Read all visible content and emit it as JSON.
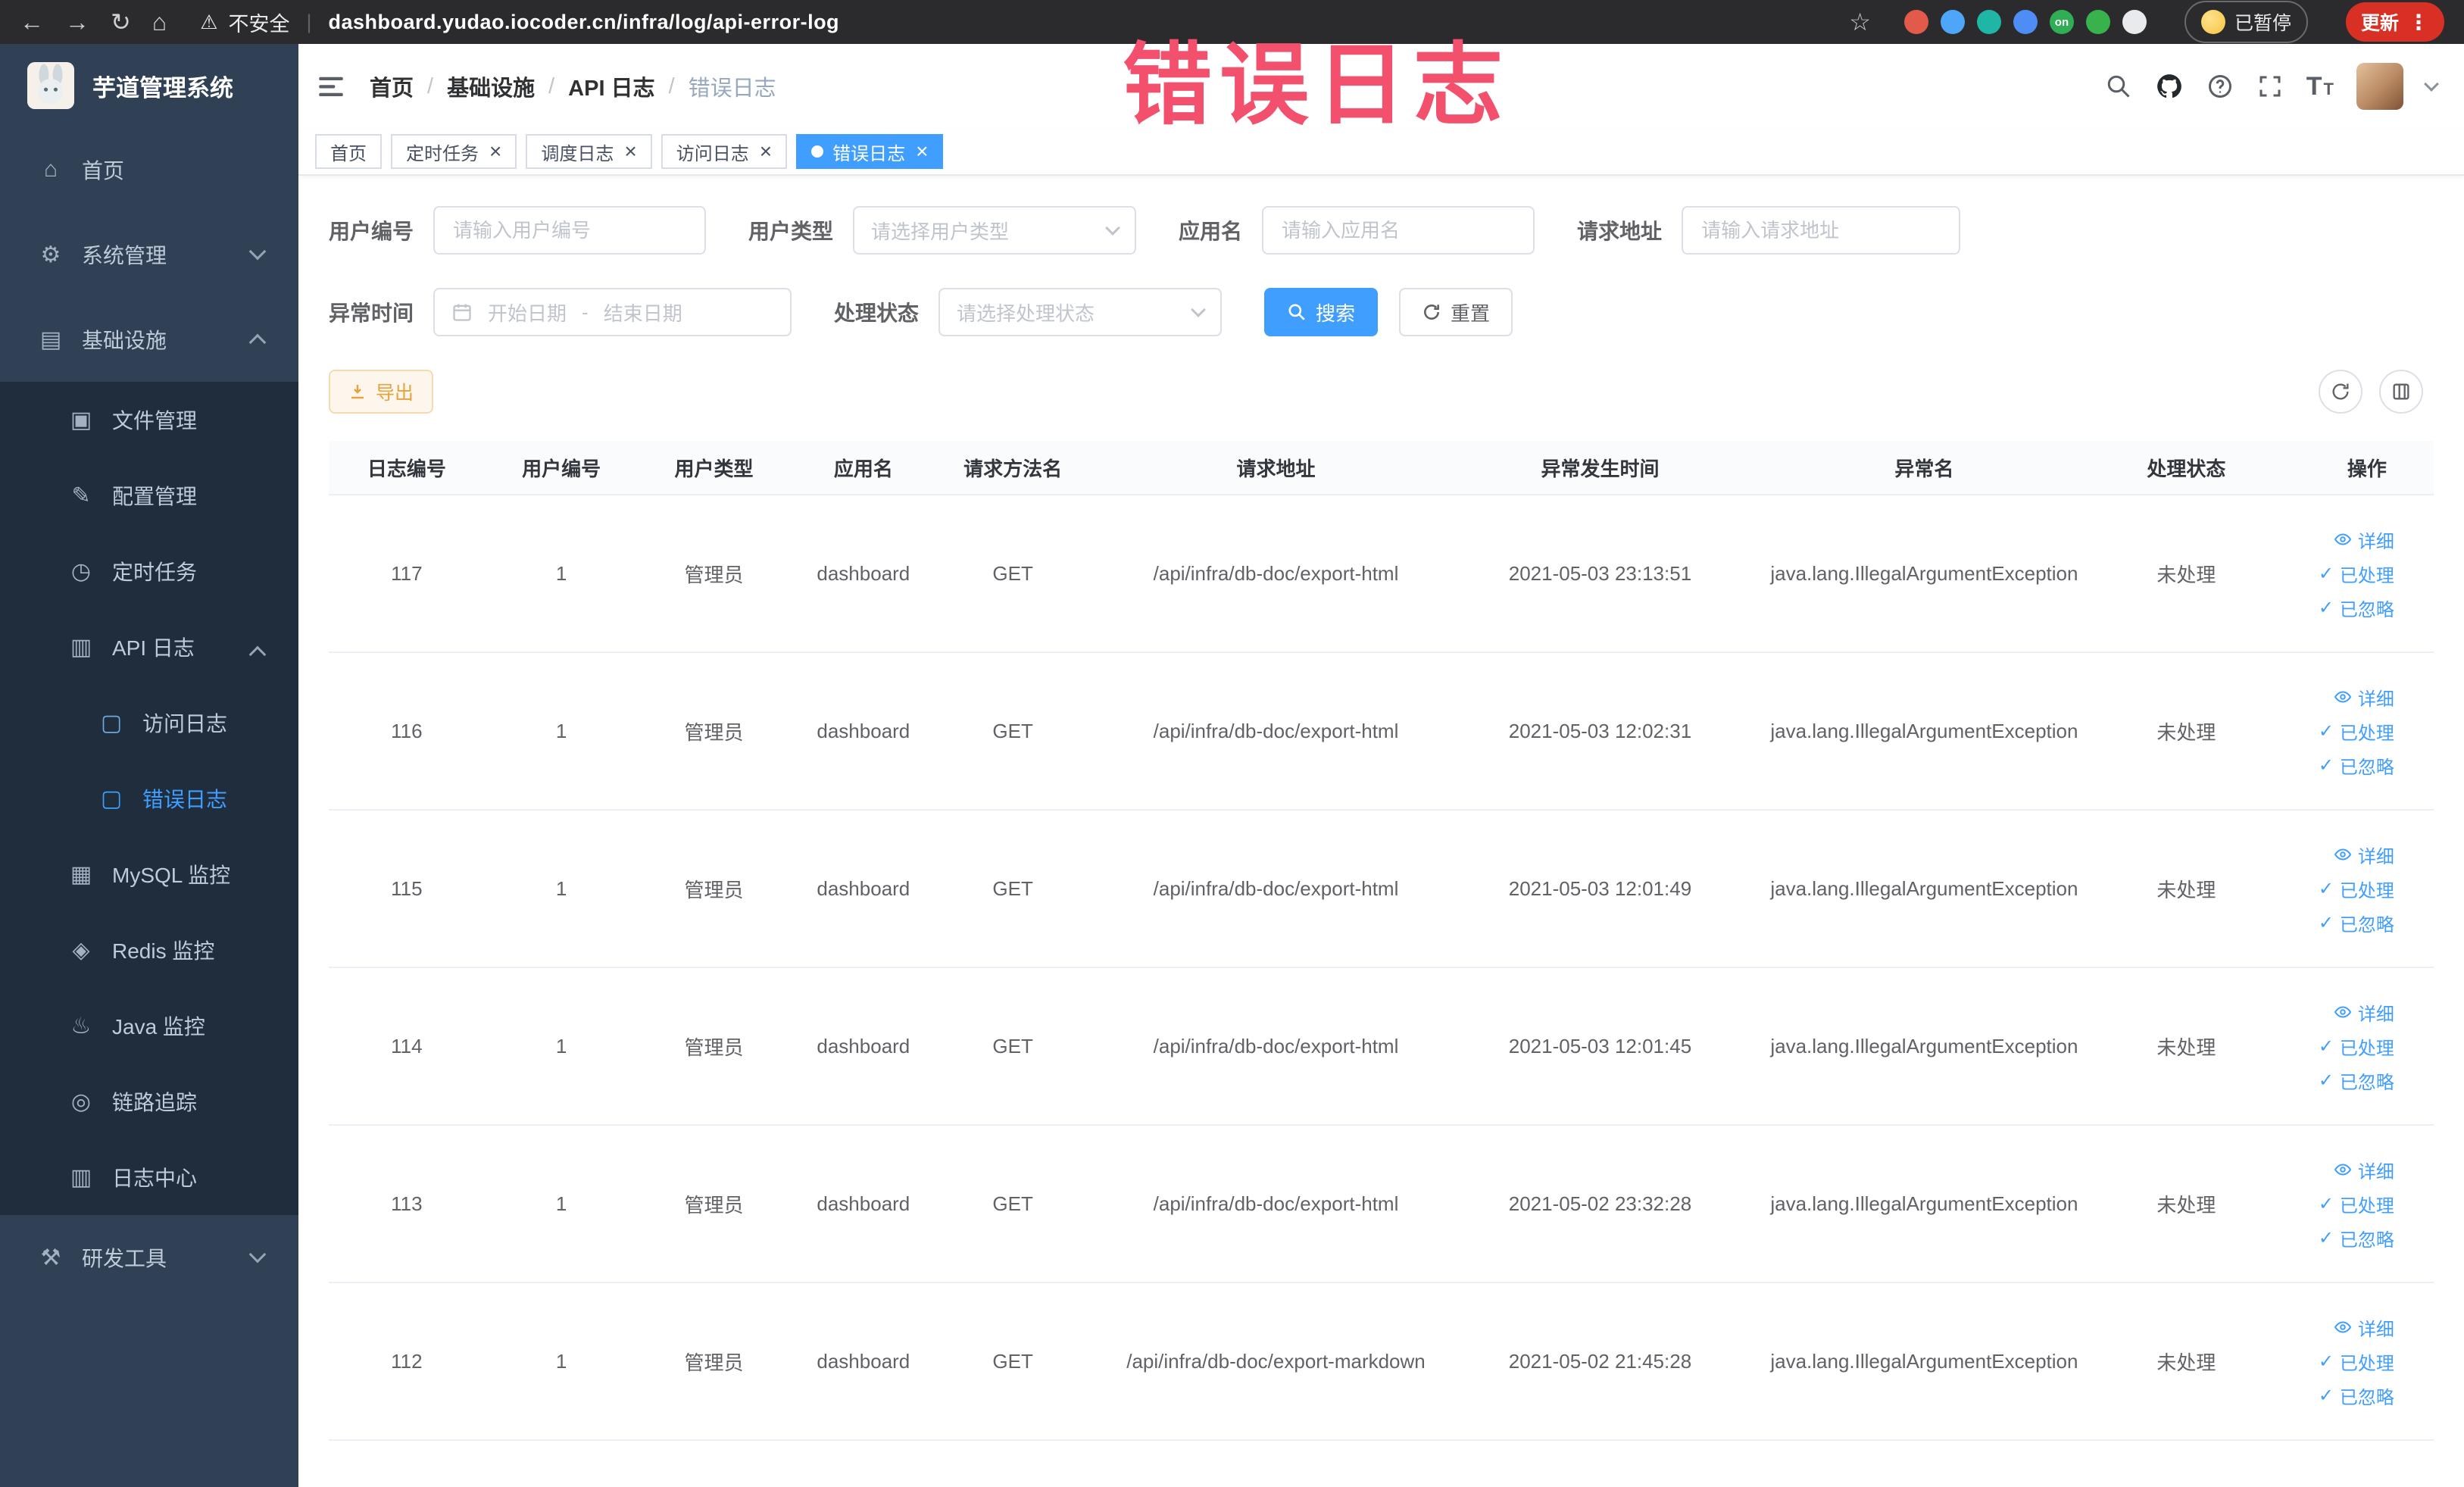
{
  "browser": {
    "security_label": "不安全",
    "url": "dashboard.yudao.iocoder.cn/infra/log/api-error-log",
    "extensions": [
      {
        "color": "#e25a4a",
        "label": ""
      },
      {
        "color": "#4ea6f8",
        "label": ""
      },
      {
        "color": "#1fb6a6",
        "label": ""
      },
      {
        "color": "#4e8df5",
        "label": ""
      },
      {
        "color": "#2fae55",
        "label": "on"
      },
      {
        "color": "#37b24d",
        "label": ""
      },
      {
        "color": "#e8eaed",
        "label": ""
      }
    ],
    "paused_label": "已暂停",
    "update_label": "更新"
  },
  "annotation": {
    "text": "错误日志",
    "color": "#f2506d"
  },
  "sidebar": {
    "logo_title": "芋道管理系统",
    "items": [
      {
        "key": "home",
        "label": "首页",
        "icon": "home-icon",
        "level": 1
      },
      {
        "key": "system-management",
        "label": "系统管理",
        "icon": "gear-icon",
        "level": 1,
        "arrow": "down"
      },
      {
        "key": "infrastructure",
        "label": "基础设施",
        "icon": "infra-icon",
        "level": 1,
        "arrow": "up"
      },
      {
        "key": "file-management",
        "label": "文件管理",
        "icon": "file-icon",
        "level": 2
      },
      {
        "key": "config-management",
        "label": "配置管理",
        "icon": "config-icon",
        "level": 2
      },
      {
        "key": "scheduled-tasks",
        "label": "定时任务",
        "icon": "timer-icon",
        "level": 2
      },
      {
        "key": "api-log",
        "label": "API 日志",
        "icon": "api-log-icon",
        "level": 2,
        "arrow": "up"
      },
      {
        "key": "access-log",
        "label": "访问日志",
        "icon": "doc-icon",
        "level": 3
      },
      {
        "key": "error-log",
        "label": "错误日志",
        "icon": "doc-icon",
        "level": 3,
        "active": true
      },
      {
        "key": "mysql-monitor",
        "label": "MySQL 监控",
        "icon": "mysql-icon",
        "level": 2
      },
      {
        "key": "redis-monitor",
        "label": "Redis 监控",
        "icon": "redis-icon",
        "level": 2
      },
      {
        "key": "java-monitor",
        "label": "Java 监控",
        "icon": "java-icon",
        "level": 2
      },
      {
        "key": "link-tracing",
        "label": "链路追踪",
        "icon": "trace-icon",
        "level": 2
      },
      {
        "key": "log-center",
        "label": "日志中心",
        "icon": "log-icon",
        "level": 2
      },
      {
        "key": "dev-tools",
        "label": "研发工具",
        "icon": "tools-icon",
        "level": 1,
        "arrow": "down"
      }
    ]
  },
  "header": {
    "breadcrumb": [
      "首页",
      "基础设施",
      "API 日志",
      "错误日志"
    ]
  },
  "tabs": [
    {
      "key": "home",
      "label": "首页",
      "closable": false,
      "active": false
    },
    {
      "key": "scheduled-tasks",
      "label": "定时任务",
      "closable": true,
      "active": false
    },
    {
      "key": "schedule-log",
      "label": "调度日志",
      "closable": true,
      "active": false
    },
    {
      "key": "access-log",
      "label": "访问日志",
      "closable": true,
      "active": false
    },
    {
      "key": "error-log",
      "label": "错误日志",
      "closable": true,
      "active": true
    }
  ],
  "filters": {
    "user_id": {
      "label": "用户编号",
      "placeholder": "请输入用户编号"
    },
    "user_type": {
      "label": "用户类型",
      "placeholder": "请选择用户类型"
    },
    "app_name": {
      "label": "应用名",
      "placeholder": "请输入应用名"
    },
    "request_url": {
      "label": "请求地址",
      "placeholder": "请输入请求地址"
    },
    "exception_time": {
      "label": "异常时间",
      "start_placeholder": "开始日期",
      "separator": "-",
      "end_placeholder": "结束日期"
    },
    "process_status": {
      "label": "处理状态",
      "placeholder": "请选择处理状态"
    },
    "search_label": "搜索",
    "reset_label": "重置"
  },
  "toolbar": {
    "export_label": "导出"
  },
  "table": {
    "columns": [
      "日志编号",
      "用户编号",
      "用户类型",
      "应用名",
      "请求方法名",
      "请求地址",
      "异常发生时间",
      "异常名",
      "处理状态",
      "操作"
    ],
    "actions": [
      "详细",
      "已处理",
      "已忽略"
    ],
    "rows": [
      {
        "id": "117",
        "user_id": "1",
        "user_type": "管理员",
        "app": "dashboard",
        "method": "GET",
        "url": "/api/infra/db-doc/export-html",
        "time": "2021-05-03 23:13:51",
        "exception": "java.lang.IllegalArgumentException",
        "status": "未处理"
      },
      {
        "id": "116",
        "user_id": "1",
        "user_type": "管理员",
        "app": "dashboard",
        "method": "GET",
        "url": "/api/infra/db-doc/export-html",
        "time": "2021-05-03 12:02:31",
        "exception": "java.lang.IllegalArgumentException",
        "status": "未处理"
      },
      {
        "id": "115",
        "user_id": "1",
        "user_type": "管理员",
        "app": "dashboard",
        "method": "GET",
        "url": "/api/infra/db-doc/export-html",
        "time": "2021-05-03 12:01:49",
        "exception": "java.lang.IllegalArgumentException",
        "status": "未处理"
      },
      {
        "id": "114",
        "user_id": "1",
        "user_type": "管理员",
        "app": "dashboard",
        "method": "GET",
        "url": "/api/infra/db-doc/export-html",
        "time": "2021-05-03 12:01:45",
        "exception": "java.lang.IllegalArgumentException",
        "status": "未处理"
      },
      {
        "id": "113",
        "user_id": "1",
        "user_type": "管理员",
        "app": "dashboard",
        "method": "GET",
        "url": "/api/infra/db-doc/export-html",
        "time": "2021-05-02 23:32:28",
        "exception": "java.lang.IllegalArgumentException",
        "status": "未处理"
      },
      {
        "id": "112",
        "user_id": "1",
        "user_type": "管理员",
        "app": "dashboard",
        "method": "GET",
        "url": "/api/infra/db-doc/export-markdown",
        "time": "2021-05-02 21:45:28",
        "exception": "java.lang.IllegalArgumentException",
        "status": "未处理"
      }
    ]
  }
}
